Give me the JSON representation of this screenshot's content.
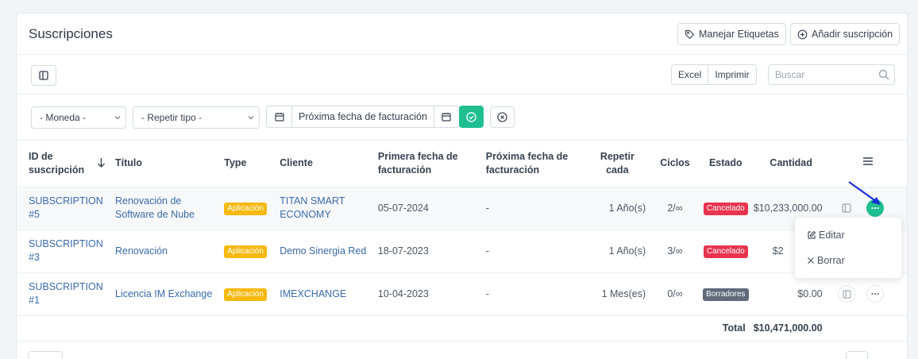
{
  "header": {
    "title": "Suscripciones",
    "manage_labels": "Manejar Etiquetas",
    "add_subscription": "Añadir suscripción"
  },
  "toolbar": {
    "excel": "Excel",
    "print": "Imprimir",
    "search_placeholder": "Buscar"
  },
  "filters": {
    "currency": "- Moneda -",
    "repeat_type": "- Repetir tipo -",
    "next_billing_date": "Próxima fecha de facturación"
  },
  "table": {
    "headers": {
      "id": "ID de suscripción",
      "title": "Título",
      "type": "Type",
      "client": "Cliente",
      "first_billing": "Primera fecha de facturación",
      "next_billing": "Próxima fecha de facturación",
      "repeat_every": "Repetir cada",
      "cycles": "Ciclos",
      "status": "Estado",
      "amount": "Cantidad"
    },
    "rows": [
      {
        "id": "SUBSCRIPTION #5",
        "title": "Renovación de Software de Nube",
        "type": "Aplicación",
        "client": "TITAN SMART ECONOMY",
        "first_billing": "05-07-2024",
        "next_billing": "-",
        "repeat_every": "1 Año(s)",
        "cycles": "2/∞",
        "status": "Cancelado",
        "amount": "$10,233,000.00"
      },
      {
        "id": "SUBSCRIPTION #3",
        "title": "Renovación",
        "type": "Aplicación",
        "client": "Demo Sinergia Red",
        "first_billing": "18-07-2023",
        "next_billing": "-",
        "repeat_every": "1 Año(s)",
        "cycles": "3/∞",
        "status": "Cancelado",
        "amount": "$2"
      },
      {
        "id": "SUBSCRIPTION #1",
        "title": "Licencia IM Exchange",
        "type": "Aplicación",
        "client": "IMEXCHANGE",
        "first_billing": "10-04-2023",
        "next_billing": "-",
        "repeat_every": "1 Mes(es)",
        "cycles": "0/∞",
        "status": "Borradores",
        "amount": "$0.00"
      }
    ],
    "total_label": "Total",
    "total_value": "$10,471,000.00"
  },
  "menu": {
    "edit": "Editar",
    "delete": "Borrar"
  },
  "colors": {
    "accent": "#1fbf8f",
    "link": "#3a6aa8",
    "badge_type": "#f5b90f",
    "badge_cancel": "#e8344e",
    "badge_draft": "#5f6b7a",
    "annotation_arrow": "#1a2fd6"
  }
}
